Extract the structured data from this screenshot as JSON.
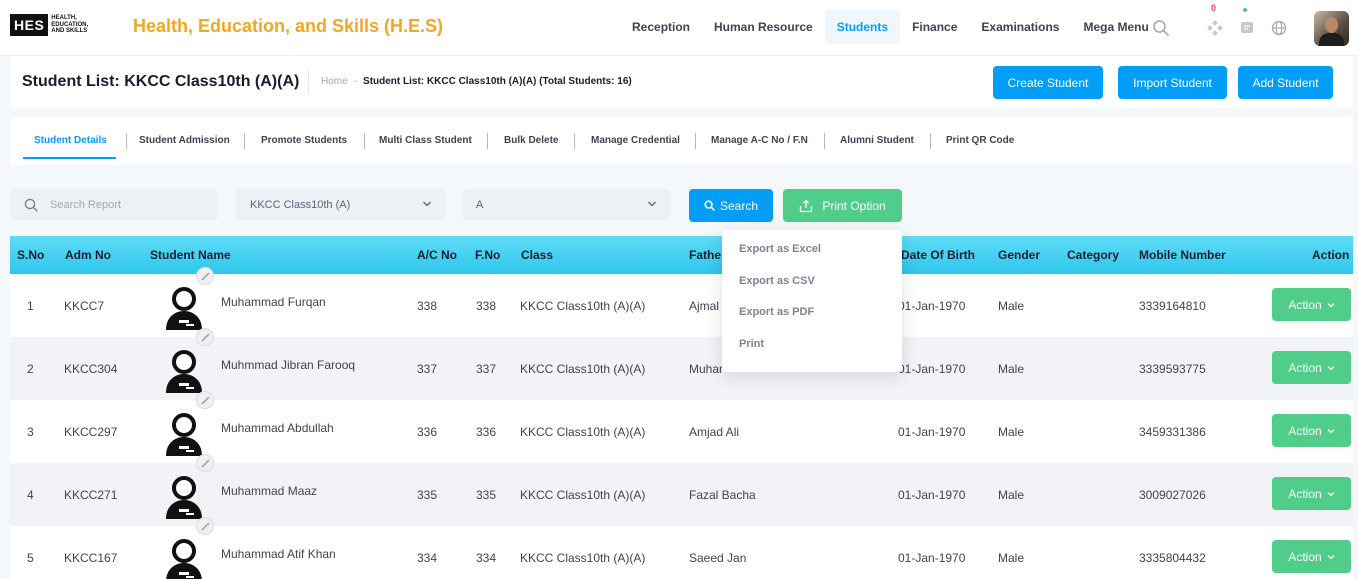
{
  "logo": {
    "mark": "HES",
    "words_1": "HEALTH,",
    "words_2": "EDUCATION,",
    "words_3": "AND SKILLS"
  },
  "app_title": "Health, Education, and Skills (H.E.S)",
  "nav": {
    "items": [
      {
        "label": "Reception"
      },
      {
        "label": "Human Resource"
      },
      {
        "label": "Students",
        "active": true
      },
      {
        "label": "Finance"
      },
      {
        "label": "Examinations"
      },
      {
        "label": "Mega Menu"
      }
    ],
    "notification_count": "0",
    "icons": [
      "search-icon",
      "apps-icon",
      "chat-icon",
      "globe-icon"
    ]
  },
  "header": {
    "title": "Student List: KKCC Class10th (A)(A)",
    "breadcrumb_home": "Home",
    "breadcrumb_sep": "-",
    "breadcrumb_current": "Student List: KKCC Class10th (A)(A) (Total Students: 16)",
    "buttons": {
      "create": "Create Student",
      "import": "Import Student",
      "add": "Add Student"
    }
  },
  "tabs": [
    "Student Details",
    "Student Admission",
    "Promote Students",
    "Multi Class Student",
    "Bulk Delete",
    "Manage Credential",
    "Manage A-C No / F.N",
    "Alumni Student",
    "Print QR Code"
  ],
  "filters": {
    "search_placeholder": "Search Report",
    "class_value": "KKCC Class10th (A)",
    "section_value": "A",
    "search_button": "Search",
    "print_button": "Print Option"
  },
  "print_menu": [
    "Export as Excel",
    "Export as CSV",
    "Export as PDF",
    "Print"
  ],
  "table": {
    "headers": {
      "sno": "S.No",
      "adm": "Adm No",
      "name": "Student Name",
      "ac": "A/C No",
      "fno": "F.No",
      "class": "Class",
      "father": "Fathe",
      "dob": "Date Of Birth",
      "gender": "Gender",
      "category": "Category",
      "mobile": "Mobile Number",
      "action": "Action"
    },
    "action_label": "Action",
    "rows": [
      {
        "sno": "1",
        "adm": "KKCC7",
        "name": "Muhammad Furqan",
        "ac": "338",
        "fno": "338",
        "class": "KKCC Class10th (A)(A)",
        "father": "Ajmal",
        "dob": "01-Jan-1970",
        "gender": "Male",
        "mobile": "3339164810"
      },
      {
        "sno": "2",
        "adm": "KKCC304",
        "name": "Muhmmad Jibran Farooq",
        "ac": "337",
        "fno": "337",
        "class": "KKCC Class10th (A)(A)",
        "father": "Muhar",
        "dob": "01-Jan-1970",
        "gender": "Male",
        "mobile": "3339593775"
      },
      {
        "sno": "3",
        "adm": "KKCC297",
        "name": "Muhammad Abdullah",
        "ac": "336",
        "fno": "336",
        "class": "KKCC Class10th (A)(A)",
        "father": "Amjad Ali",
        "dob": "01-Jan-1970",
        "gender": "Male",
        "mobile": "3459331386"
      },
      {
        "sno": "4",
        "adm": "KKCC271",
        "name": "Muhammad Maaz",
        "ac": "335",
        "fno": "335",
        "class": "KKCC Class10th (A)(A)",
        "father": "Fazal Bacha",
        "dob": "01-Jan-1970",
        "gender": "Male",
        "mobile": "3009027026"
      },
      {
        "sno": "5",
        "adm": "KKCC167",
        "name": "Muhammad Atif Khan",
        "ac": "334",
        "fno": "334",
        "class": "KKCC Class10th (A)(A)",
        "father": "Saeed Jan",
        "dob": "01-Jan-1970",
        "gender": "Male",
        "mobile": "3335804432"
      }
    ]
  },
  "colors": {
    "primary": "#009ef7",
    "success": "#50cd89",
    "brand": "#f0a824",
    "table_header": "#2ec7ec"
  }
}
